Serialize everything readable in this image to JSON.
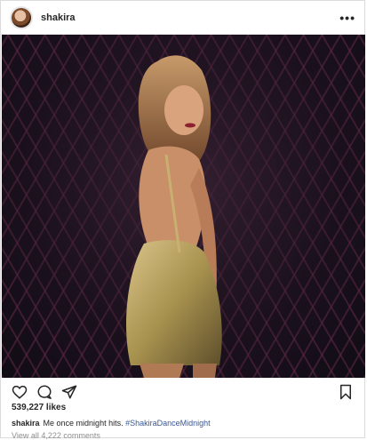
{
  "header": {
    "username": "shakira",
    "more_label": "•••"
  },
  "actions": {
    "like_icon": "heart-icon",
    "comment_icon": "comment-icon",
    "share_icon": "share-icon",
    "save_icon": "bookmark-icon"
  },
  "likes": "539,227 likes",
  "caption": {
    "username": "shakira",
    "text": "Me once midnight hits.",
    "hashtag": "#ShakiraDanceMidnight"
  },
  "comments_link": "View all 4,222 comments",
  "colors": {
    "hashtag": "#385898",
    "muted": "#8e8e8e",
    "border": "#dbdbdb"
  }
}
